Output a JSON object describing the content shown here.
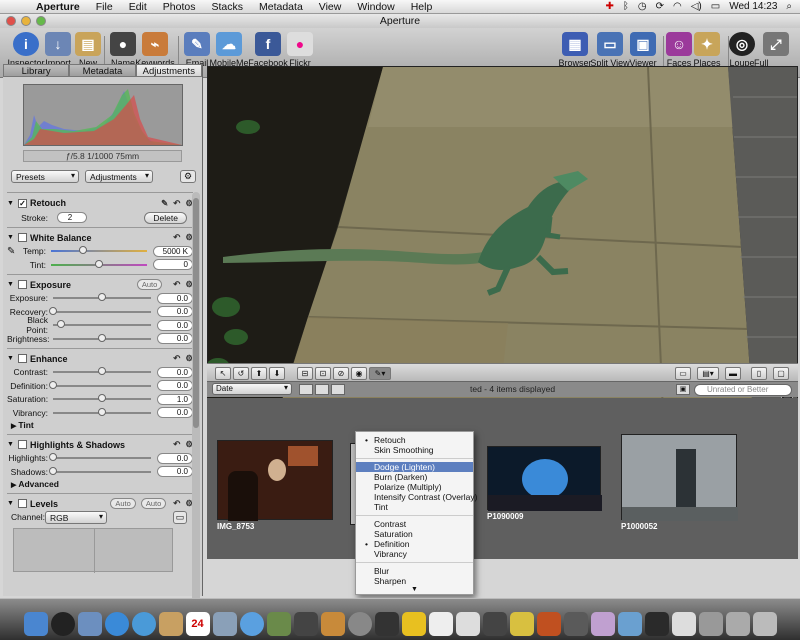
{
  "menubar": {
    "app": "Aperture",
    "items": [
      "File",
      "Edit",
      "Photos",
      "Stacks",
      "Metadata",
      "View",
      "Window",
      "Help"
    ],
    "clock": "Wed 14:23"
  },
  "window": {
    "title": "Aperture"
  },
  "toolbar": {
    "inspector": "Inspector",
    "import": "Import",
    "new": "New",
    "name": "Name",
    "keywords": "Keywords",
    "email": "Email",
    "mobileme": "MobileMe",
    "facebook": "Facebook",
    "flickr": "Flickr",
    "browser": "Browser",
    "splitview": "Split View",
    "viewer": "Viewer",
    "faces": "Faces",
    "places": "Places",
    "loupe": "Loupe",
    "fullscreen": "Full Screen"
  },
  "inspector": {
    "tabs": [
      "Library",
      "Metadata",
      "Adjustments"
    ],
    "active_tab": "Adjustments",
    "exif": "ƒ/5.8    1/1000    75mm",
    "presets": "Presets",
    "adjustments": "Adjustments"
  },
  "retouch": {
    "title": "Retouch",
    "stroke_label": "Stroke:",
    "stroke": "2",
    "delete": "Delete"
  },
  "white_balance": {
    "title": "White Balance",
    "temp_label": "Temp:",
    "temp": "5000 K",
    "temp_level": 0.33,
    "tint_label": "Tint:",
    "tint": "0",
    "tint_level": 0.5
  },
  "exposure": {
    "title": "Exposure",
    "auto": "Auto",
    "rows": [
      {
        "label": "Exposure:",
        "value": "0.0",
        "level": 0.5
      },
      {
        "label": "Recovery:",
        "value": "0.0",
        "level": 0.0
      },
      {
        "label": "Black Point:",
        "value": "0.0",
        "level": 0.08
      },
      {
        "label": "Brightness:",
        "value": "0.0",
        "level": 0.5
      }
    ]
  },
  "enhance": {
    "title": "Enhance",
    "rows": [
      {
        "label": "Contrast:",
        "value": "0.0",
        "level": 0.5
      },
      {
        "label": "Definition:",
        "value": "0.0",
        "level": 0.0
      },
      {
        "label": "Saturation:",
        "value": "1.0",
        "level": 0.5
      },
      {
        "label": "Vibrancy:",
        "value": "0.0",
        "level": 0.5
      }
    ],
    "tint": "Tint"
  },
  "highlights_shadows": {
    "title": "Highlights & Shadows",
    "rows": [
      {
        "label": "Highlights:",
        "value": "0.0",
        "level": 0.0
      },
      {
        "label": "Shadows:",
        "value": "0.0",
        "level": 0.0
      }
    ],
    "advanced": "Advanced"
  },
  "levels": {
    "title": "Levels",
    "auto1": "Auto",
    "auto2": "Auto",
    "channel_label": "Channel:",
    "channel": "RGB"
  },
  "browser": {
    "sort": "Date",
    "status": "ted - 4 items displayed",
    "search_placeholder": "Unrated or Better",
    "thumbs": [
      {
        "name": "IMG_8753"
      },
      {
        "name": ""
      },
      {
        "name": "P1090009"
      },
      {
        "name": "P1000052"
      }
    ]
  },
  "brush_menu": {
    "groups": [
      [
        {
          "label": "Retouch",
          "checked": true
        },
        {
          "label": "Skin Smoothing",
          "checked": false
        }
      ],
      [
        {
          "label": "Dodge (Lighten)",
          "checked": false,
          "highlight": true
        },
        {
          "label": "Burn (Darken)",
          "checked": false
        },
        {
          "label": "Polarize (Multiply)",
          "checked": false
        },
        {
          "label": "Intensify Contrast (Overlay)",
          "checked": false
        },
        {
          "label": "Tint",
          "checked": false
        }
      ],
      [
        {
          "label": "Contrast",
          "checked": false
        },
        {
          "label": "Saturation",
          "checked": false
        },
        {
          "label": "Definition",
          "checked": true
        },
        {
          "label": "Vibrancy",
          "checked": false
        }
      ],
      [
        {
          "label": "Blur",
          "checked": false
        },
        {
          "label": "Sharpen",
          "checked": false
        }
      ]
    ]
  },
  "dock": {
    "calendar_day": "24"
  }
}
